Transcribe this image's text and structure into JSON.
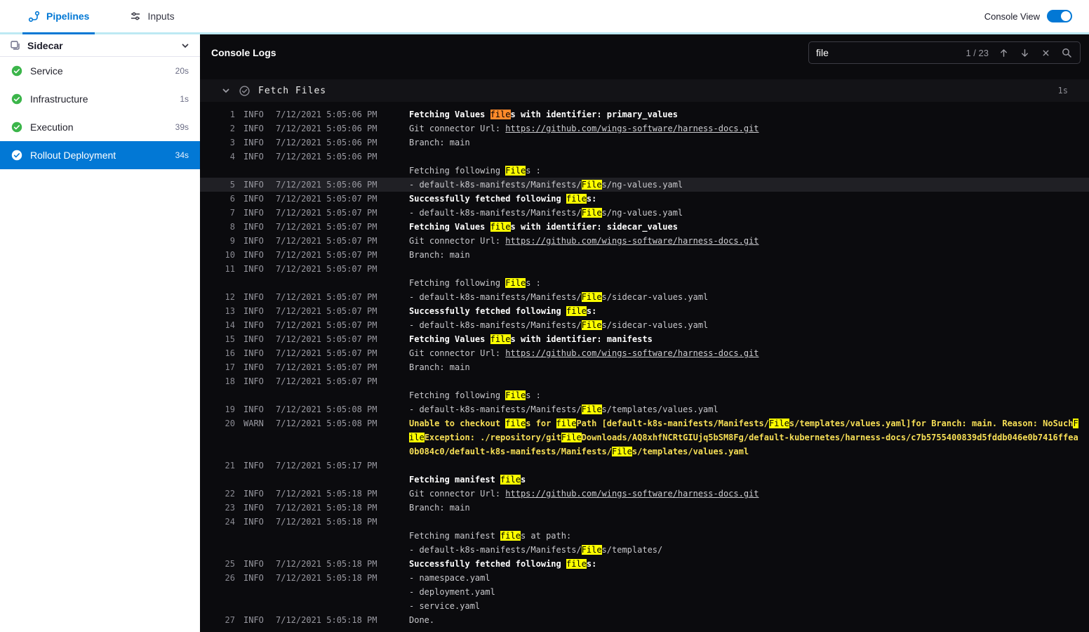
{
  "navbar": {
    "tabs": [
      {
        "label": "Pipelines"
      },
      {
        "label": "Inputs"
      }
    ],
    "console_view_label": "Console View",
    "console_view_on": true
  },
  "sidebar": {
    "title": "Sidecar",
    "items": [
      {
        "label": "Service",
        "duration": "20s",
        "selected": false
      },
      {
        "label": "Infrastructure",
        "duration": "1s",
        "selected": false
      },
      {
        "label": "Execution",
        "duration": "39s",
        "selected": false
      },
      {
        "label": "Rollout Deployment",
        "duration": "34s",
        "selected": true
      }
    ]
  },
  "console": {
    "title": "Console Logs",
    "search": {
      "value": "file",
      "counter": "1 / 23"
    },
    "section": {
      "title": "Fetch Files",
      "duration": "1s"
    },
    "logs": [
      {
        "n": 1,
        "lvl": "INFO",
        "time": "7/12/2021 5:05:06 PM",
        "lines": [
          [
            [
              "b",
              "Fetching Values "
            ],
            [
              "c",
              "file"
            ],
            [
              "b",
              "s with identifier: primary_values"
            ]
          ]
        ]
      },
      {
        "n": 2,
        "lvl": "INFO",
        "time": "7/12/2021 5:05:06 PM",
        "lines": [
          [
            [
              "p",
              "Git connector Url: "
            ],
            [
              "l",
              "https://github.com/wings-software/harness-docs.git"
            ]
          ]
        ]
      },
      {
        "n": 3,
        "lvl": "INFO",
        "time": "7/12/2021 5:05:06 PM",
        "lines": [
          [
            [
              "p",
              "Branch: main"
            ]
          ]
        ]
      },
      {
        "n": 4,
        "lvl": "INFO",
        "time": "7/12/2021 5:05:06 PM",
        "lines": [
          [],
          [
            [
              "p",
              "Fetching following "
            ],
            [
              "h",
              "File"
            ],
            [
              "p",
              "s :"
            ]
          ]
        ]
      },
      {
        "n": 5,
        "lvl": "INFO",
        "time": "7/12/2021 5:05:06 PM",
        "sel": true,
        "lines": [
          [
            [
              "p",
              "- default-k8s-manifests/Manifests/"
            ],
            [
              "h",
              "File"
            ],
            [
              "p",
              "s/ng-values.yaml"
            ]
          ]
        ]
      },
      {
        "n": 6,
        "lvl": "INFO",
        "time": "7/12/2021 5:05:07 PM",
        "lines": [
          [
            [
              "b",
              "Successfully fetched following "
            ],
            [
              "h",
              "file"
            ],
            [
              "b",
              "s:"
            ]
          ]
        ]
      },
      {
        "n": 7,
        "lvl": "INFO",
        "time": "7/12/2021 5:05:07 PM",
        "lines": [
          [
            [
              "p",
              "- default-k8s-manifests/Manifests/"
            ],
            [
              "h",
              "File"
            ],
            [
              "p",
              "s/ng-values.yaml"
            ]
          ]
        ]
      },
      {
        "n": 8,
        "lvl": "INFO",
        "time": "7/12/2021 5:05:07 PM",
        "lines": [
          [
            [
              "b",
              "Fetching Values "
            ],
            [
              "h",
              "file"
            ],
            [
              "b",
              "s with identifier: sidecar_values"
            ]
          ]
        ]
      },
      {
        "n": 9,
        "lvl": "INFO",
        "time": "7/12/2021 5:05:07 PM",
        "lines": [
          [
            [
              "p",
              "Git connector Url: "
            ],
            [
              "l",
              "https://github.com/wings-software/harness-docs.git"
            ]
          ]
        ]
      },
      {
        "n": 10,
        "lvl": "INFO",
        "time": "7/12/2021 5:05:07 PM",
        "lines": [
          [
            [
              "p",
              "Branch: main"
            ]
          ]
        ]
      },
      {
        "n": 11,
        "lvl": "INFO",
        "time": "7/12/2021 5:05:07 PM",
        "lines": [
          [],
          [
            [
              "p",
              "Fetching following "
            ],
            [
              "h",
              "File"
            ],
            [
              "p",
              "s :"
            ]
          ]
        ]
      },
      {
        "n": 12,
        "lvl": "INFO",
        "time": "7/12/2021 5:05:07 PM",
        "lines": [
          [
            [
              "p",
              "- default-k8s-manifests/Manifests/"
            ],
            [
              "h",
              "File"
            ],
            [
              "p",
              "s/sidecar-values.yaml"
            ]
          ]
        ]
      },
      {
        "n": 13,
        "lvl": "INFO",
        "time": "7/12/2021 5:05:07 PM",
        "lines": [
          [
            [
              "b",
              "Successfully fetched following "
            ],
            [
              "h",
              "file"
            ],
            [
              "b",
              "s:"
            ]
          ]
        ]
      },
      {
        "n": 14,
        "lvl": "INFO",
        "time": "7/12/2021 5:05:07 PM",
        "lines": [
          [
            [
              "p",
              "- default-k8s-manifests/Manifests/"
            ],
            [
              "h",
              "File"
            ],
            [
              "p",
              "s/sidecar-values.yaml"
            ]
          ]
        ]
      },
      {
        "n": 15,
        "lvl": "INFO",
        "time": "7/12/2021 5:05:07 PM",
        "lines": [
          [
            [
              "b",
              "Fetching Values "
            ],
            [
              "h",
              "file"
            ],
            [
              "b",
              "s with identifier: manifests"
            ]
          ]
        ]
      },
      {
        "n": 16,
        "lvl": "INFO",
        "time": "7/12/2021 5:05:07 PM",
        "lines": [
          [
            [
              "p",
              "Git connector Url: "
            ],
            [
              "l",
              "https://github.com/wings-software/harness-docs.git"
            ]
          ]
        ]
      },
      {
        "n": 17,
        "lvl": "INFO",
        "time": "7/12/2021 5:05:07 PM",
        "lines": [
          [
            [
              "p",
              "Branch: main"
            ]
          ]
        ]
      },
      {
        "n": 18,
        "lvl": "INFO",
        "time": "7/12/2021 5:05:07 PM",
        "lines": [
          [],
          [
            [
              "p",
              "Fetching following "
            ],
            [
              "h",
              "File"
            ],
            [
              "p",
              "s :"
            ]
          ]
        ]
      },
      {
        "n": 19,
        "lvl": "INFO",
        "time": "7/12/2021 5:05:08 PM",
        "lines": [
          [
            [
              "p",
              "- default-k8s-manifests/Manifests/"
            ],
            [
              "h",
              "File"
            ],
            [
              "p",
              "s/templates/values.yaml"
            ]
          ]
        ]
      },
      {
        "n": 20,
        "lvl": "WARN",
        "time": "7/12/2021 5:05:08 PM",
        "lines": [
          [
            [
              "w",
              "Unable to checkout "
            ],
            [
              "h",
              "file"
            ],
            [
              "w",
              "s for "
            ],
            [
              "h",
              "file"
            ],
            [
              "w",
              "Path [default-k8s-manifests/Manifests/"
            ],
            [
              "h",
              "File"
            ],
            [
              "w",
              "s/templates/values.yaml]for Branch: main. Reason: NoSuch"
            ],
            [
              "h",
              "File"
            ],
            [
              "w",
              "Exception: ./repository/git"
            ],
            [
              "h",
              "File"
            ],
            [
              "w",
              "Downloads/AQ8xhfNCRtGIUjq5bSM8Fg/default-kubernetes/harness-docs/c7b5755400839d5fddb046e0b7416ffea0b084c0/default-k8s-manifests/Manifests/"
            ],
            [
              "h",
              "File"
            ],
            [
              "w",
              "s/templates/values.yaml"
            ]
          ]
        ]
      },
      {
        "n": 21,
        "lvl": "INFO",
        "time": "7/12/2021 5:05:17 PM",
        "lines": [
          [],
          [
            [
              "b",
              "Fetching manifest "
            ],
            [
              "h",
              "file"
            ],
            [
              "b",
              "s"
            ]
          ]
        ]
      },
      {
        "n": 22,
        "lvl": "INFO",
        "time": "7/12/2021 5:05:18 PM",
        "lines": [
          [
            [
              "p",
              "Git connector Url: "
            ],
            [
              "l",
              "https://github.com/wings-software/harness-docs.git"
            ]
          ]
        ]
      },
      {
        "n": 23,
        "lvl": "INFO",
        "time": "7/12/2021 5:05:18 PM",
        "lines": [
          [
            [
              "p",
              "Branch: main"
            ]
          ]
        ]
      },
      {
        "n": 24,
        "lvl": "INFO",
        "time": "7/12/2021 5:05:18 PM",
        "lines": [
          [],
          [
            [
              "p",
              "Fetching manifest "
            ],
            [
              "h",
              "file"
            ],
            [
              "p",
              "s at path:"
            ]
          ],
          [
            [
              "p",
              "- default-k8s-manifests/Manifests/"
            ],
            [
              "h",
              "File"
            ],
            [
              "p",
              "s/templates/"
            ]
          ]
        ]
      },
      {
        "n": 25,
        "lvl": "INFO",
        "time": "7/12/2021 5:05:18 PM",
        "lines": [
          [
            [
              "b",
              "Successfully fetched following "
            ],
            [
              "h",
              "file"
            ],
            [
              "b",
              "s:"
            ]
          ]
        ]
      },
      {
        "n": 26,
        "lvl": "INFO",
        "time": "7/12/2021 5:05:18 PM",
        "lines": [
          [
            [
              "p",
              "- namespace.yaml"
            ]
          ],
          [
            [
              "p",
              "- deployment.yaml"
            ]
          ],
          [
            [
              "p",
              "- service.yaml"
            ]
          ]
        ]
      },
      {
        "n": 27,
        "lvl": "INFO",
        "time": "7/12/2021 5:05:18 PM",
        "lines": [
          [
            [
              "p",
              "Done."
            ]
          ]
        ]
      }
    ]
  },
  "icons": {
    "pipelines-icon": "pipeline-nodes",
    "inputs-icon": "sliders",
    "stage-icon": "stage-outline",
    "chevron-down-icon": "⌄",
    "success-check-icon": "✓",
    "prev-match-icon": "↑",
    "next-match-icon": "↓",
    "clear-search-icon": "×",
    "search-icon": "⌕"
  },
  "colors": {
    "accent_blue": "#0278d5",
    "success_green": "#3bb54a",
    "console_bg": "#0b0b0e",
    "highlight_yellow": "#fdff00",
    "highlight_current_orange": "#ff8a2a",
    "warn_text": "#f7df56",
    "nav_underline_teal": "#bde9f3"
  }
}
